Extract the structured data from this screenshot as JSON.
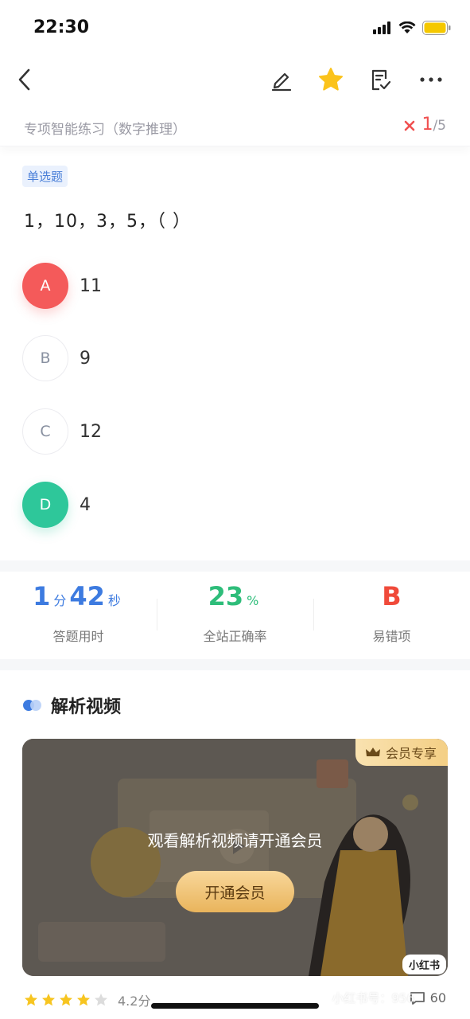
{
  "status": {
    "time": "22:30"
  },
  "header": {
    "subtitle": "专项智能练习（数字推理）",
    "progress_current": "1",
    "progress_total": "/5"
  },
  "question": {
    "type_tag": "单选题",
    "text": "1，10，3，5，（ ）",
    "options": [
      {
        "letter": "A",
        "value": "11",
        "state": "wrong"
      },
      {
        "letter": "B",
        "value": "9",
        "state": "normal"
      },
      {
        "letter": "C",
        "value": "12",
        "state": "normal"
      },
      {
        "letter": "D",
        "value": "4",
        "state": "correct"
      }
    ]
  },
  "stats": {
    "time_min": "1",
    "time_min_unit": "分",
    "time_sec": "42",
    "time_sec_unit": "秒",
    "time_label": "答题用时",
    "accuracy": "23",
    "accuracy_unit": "%",
    "accuracy_label": "全站正确率",
    "error_option": "B",
    "error_label": "易错项"
  },
  "analysis": {
    "section_title": "解析视频",
    "vip_tag": "会员专享",
    "video_message": "观看解析视频请开通会员",
    "open_button": "开通会员",
    "brand_badge": "小红书"
  },
  "footer": {
    "rating": "4.2分",
    "stars_filled": 4,
    "stars_total": 5,
    "comment_count": "60",
    "watermark": "小红书号：956"
  },
  "colors": {
    "wrong": "#f45a5a",
    "correct": "#2ec79a",
    "blue": "#3d7be0",
    "green": "#2ebd7a",
    "red": "#f04a3a",
    "star": "#f7c520"
  }
}
